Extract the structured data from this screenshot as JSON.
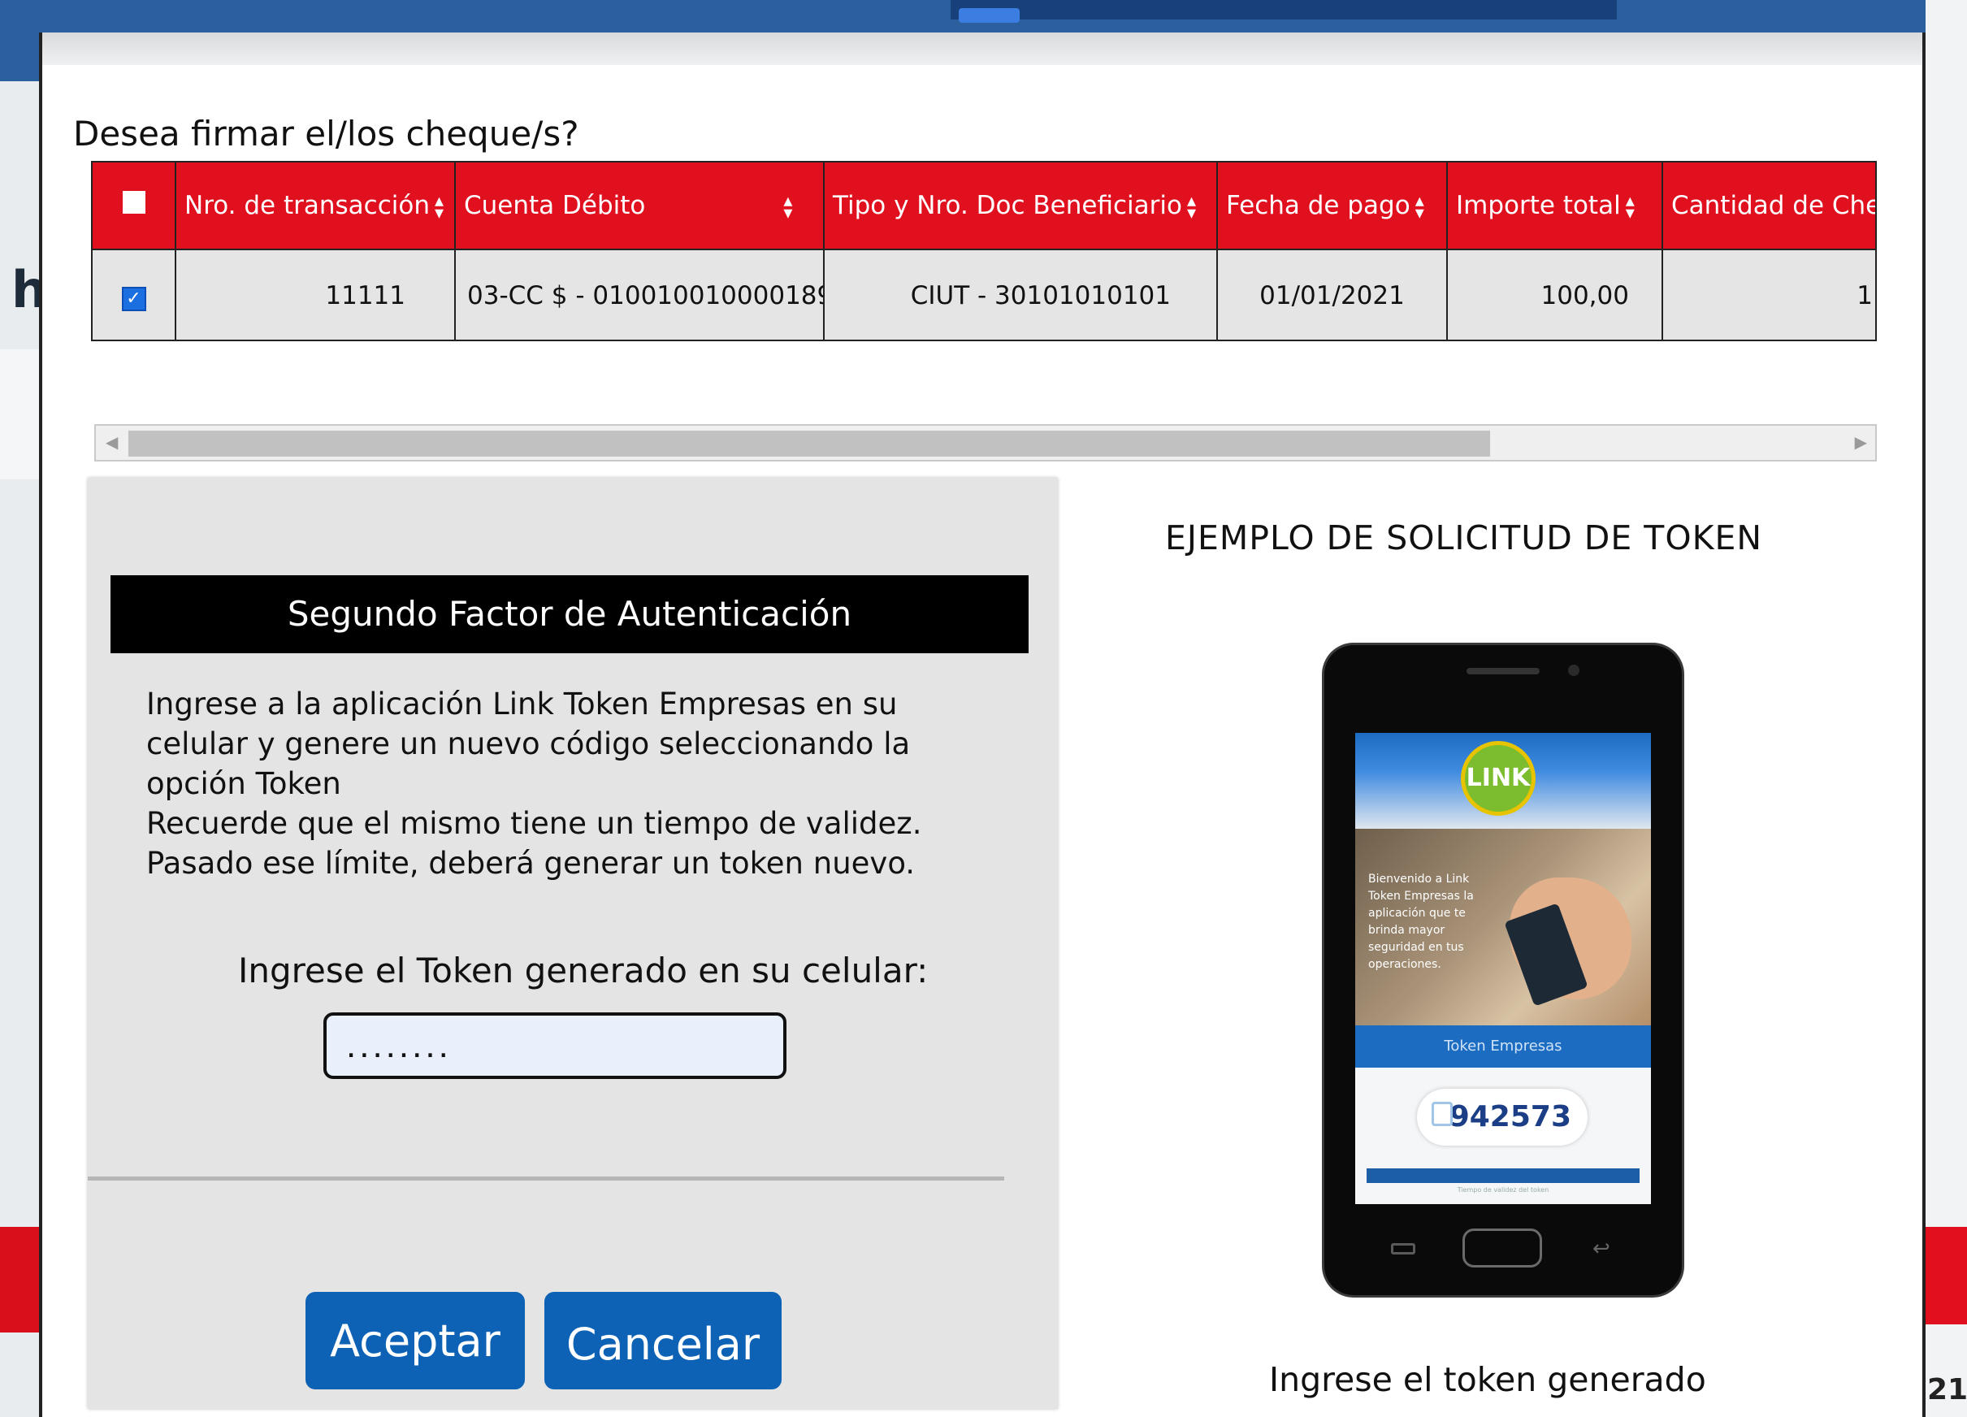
{
  "dialog": {
    "title": "Desea firmar el/los cheque/s?"
  },
  "table": {
    "columns": [
      "Nro. de transacción",
      "Cuenta Débito",
      "Tipo y Nro. Doc Beneficiario",
      "Fecha de pago",
      "Importe total",
      "Cantidad de Che"
    ],
    "rows": [
      {
        "checked": true,
        "transaction": "11111",
        "account": "03-CC $ - 010010010000189",
        "beneficiary": "CIUT - 30101010101",
        "date": "01/01/2021",
        "amount": "100,00",
        "count": "1"
      }
    ]
  },
  "auth": {
    "header": "Segundo Factor de Autenticación",
    "instructions": [
      "Ingrese a la aplicación Link Token Empresas en su",
      "celular y genere un nuevo código seleccionando la",
      "opción Token",
      "Recuerde que el mismo tiene un tiempo de validez.",
      "Pasado  ese límite, deberá generar un token nuevo."
    ],
    "token_label": "Ingrese el Token generado en su celular:",
    "token_value": "........",
    "accept_label": "Aceptar",
    "cancel_label": "Cancelar"
  },
  "example": {
    "title": "EJEMPLO DE SOLICITUD DE TOKEN",
    "caption": "Ingrese el token generado",
    "phone": {
      "logo": "LINK",
      "welcome": "Bienvenido a Link Token Empresas la aplicación que te brinda mayor seguridad en tus operaciones.",
      "band": "Token Empresas",
      "code": "942573",
      "progress_label": "Tiempo de validez del token"
    }
  },
  "background": {
    "left_letter": "h",
    "right_number": "21"
  },
  "colors": {
    "header_red": "#e0101e",
    "button_blue": "#0d62b5",
    "auth_header_black": "#000000",
    "panel_gray": "#e4e4e4"
  }
}
